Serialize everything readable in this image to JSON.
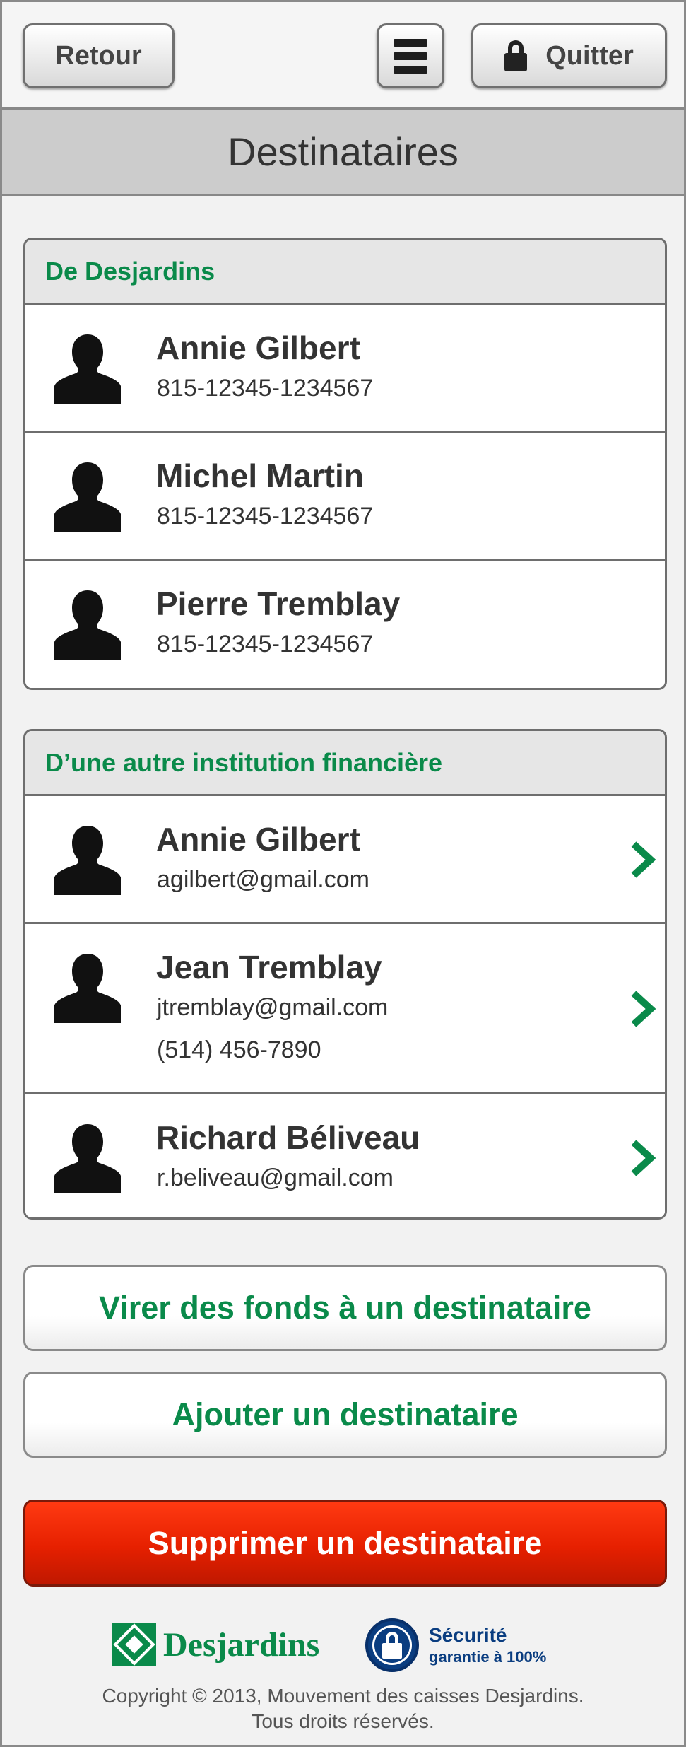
{
  "header": {
    "back_label": "Retour",
    "menu_icon": "hamburger-menu-icon",
    "quit_label": "Quitter",
    "quit_icon": "lock-icon"
  },
  "title": "Destinataires",
  "sections": [
    {
      "title": "De Desjardins",
      "recipients": [
        {
          "name": "Annie Gilbert",
          "details": [
            "815-12345-1234567"
          ]
        },
        {
          "name": "Michel Martin",
          "details": [
            "815-12345-1234567"
          ]
        },
        {
          "name": "Pierre Tremblay",
          "details": [
            "815-12345-1234567"
          ]
        }
      ]
    },
    {
      "title": "D’une autre institution financière",
      "recipients": [
        {
          "name": "Annie Gilbert",
          "details": [
            "agilbert@gmail.com"
          ]
        },
        {
          "name": "Jean Tremblay",
          "details": [
            "jtremblay@gmail.com",
            "(514) 456-7890"
          ]
        },
        {
          "name": "Richard Béliveau",
          "details": [
            "r.beliveau@gmail.com"
          ]
        }
      ]
    }
  ],
  "actions": {
    "transfer_label": "Virer des fonds à un destinataire",
    "add_label": "Ajouter un destinataire",
    "delete_label": "Supprimer un destinataire"
  },
  "footer": {
    "brand_name": "Desjardins",
    "security_line1": "Sécurité",
    "security_line2": "garantie à 100%",
    "copyright_line1": "Copyright © 2013, Mouvement des caisses Desjardins.",
    "copyright_line2": "Tous droits réservés."
  },
  "colors": {
    "accent_green": "#0a8a4a",
    "delete_red": "#e62000",
    "security_blue": "#0a3d80"
  }
}
